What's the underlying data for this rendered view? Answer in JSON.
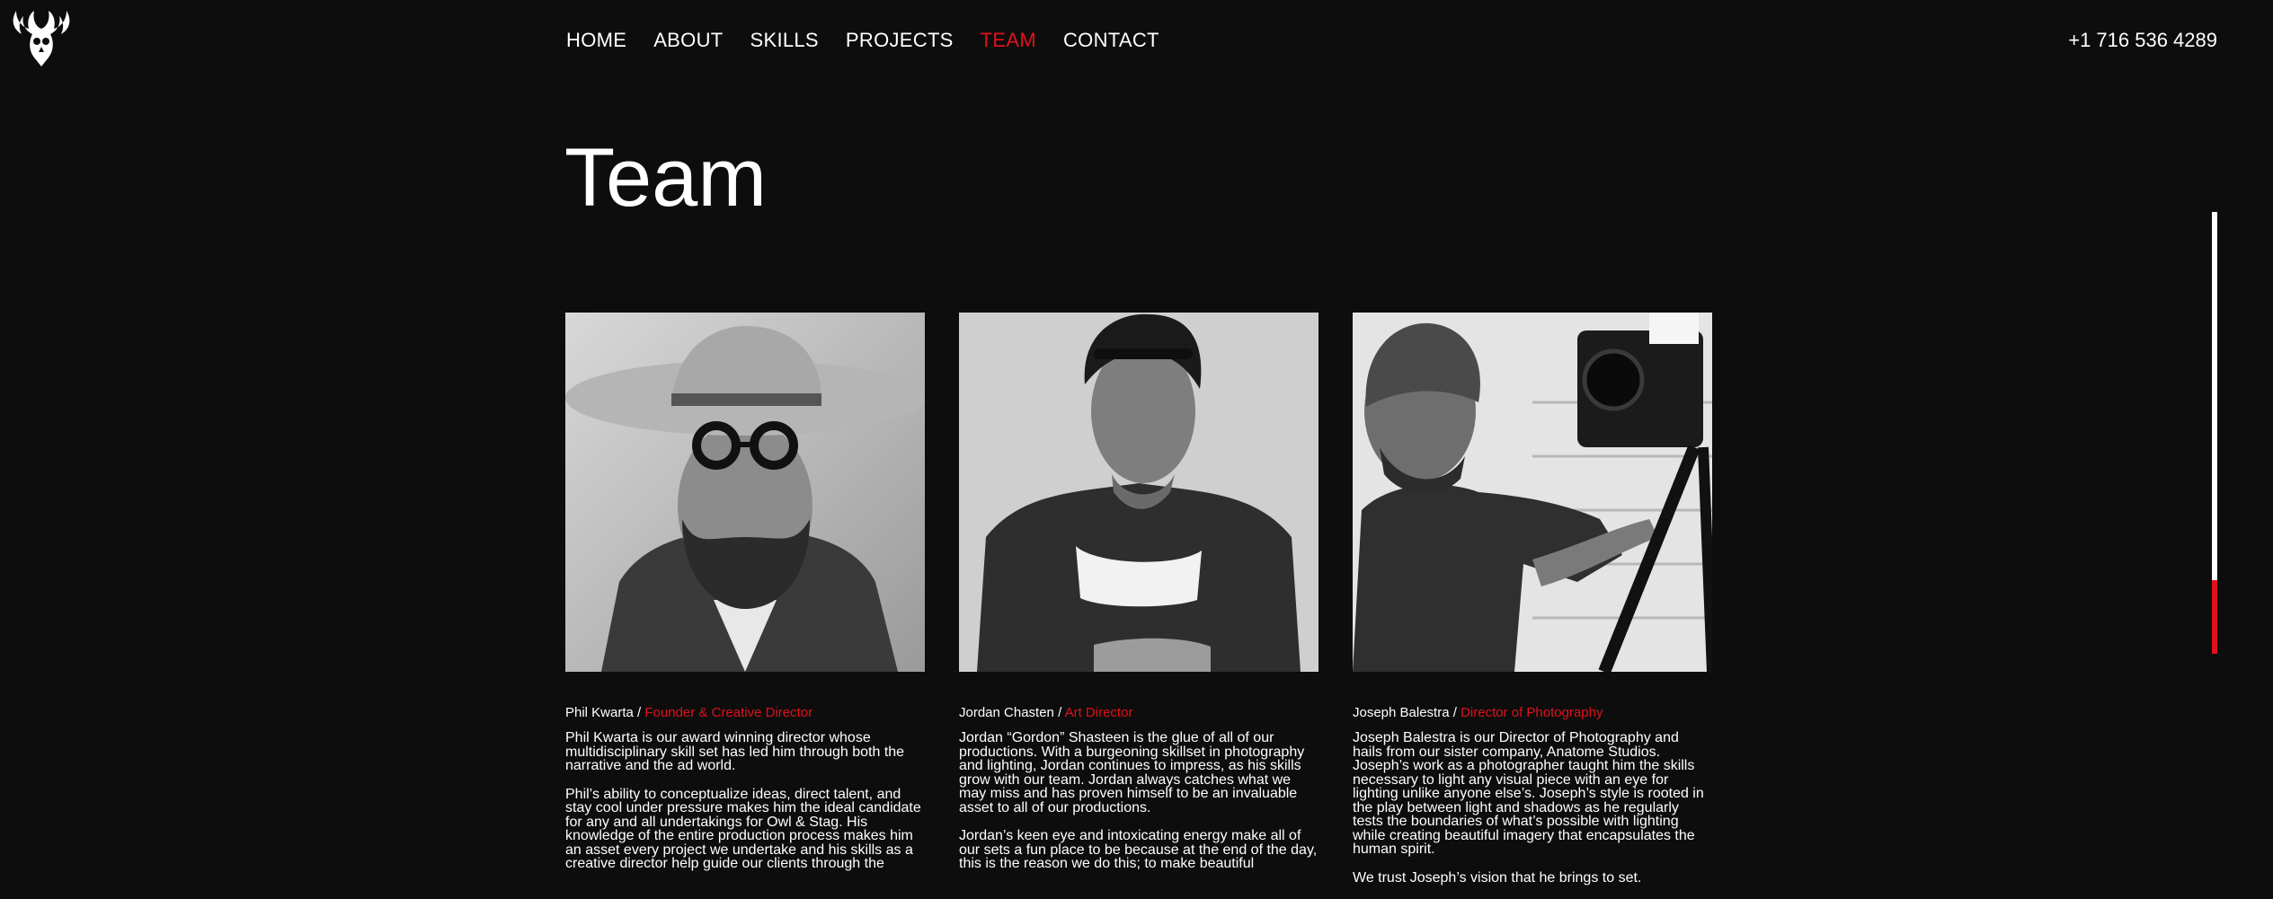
{
  "nav": {
    "items": [
      {
        "label": "HOME"
      },
      {
        "label": "ABOUT"
      },
      {
        "label": "SKILLS"
      },
      {
        "label": "PROJECTS"
      },
      {
        "label": "TEAM",
        "active": true
      },
      {
        "label": "CONTACT"
      }
    ],
    "phone": "+1 716 536 4289"
  },
  "page": {
    "title": "Team"
  },
  "colors": {
    "background": "#0d0d0d",
    "accent": "#e0111b",
    "text": "#ffffff"
  },
  "team": [
    {
      "name": "Phil Kwarta /",
      "role": "Founder & Creative Director",
      "bio": [
        "Phil Kwarta is our award winning director whose multidisciplinary skill set has led him through both the narrative and the ad world.",
        "Phil’s ability to conceptualize ideas, direct talent, and stay cool under pressure makes him the ideal candidate for any and all undertakings for Owl & Stag. His knowledge of the entire production process makes him an asset every project we undertake and his skills as a creative director help guide our clients through the"
      ]
    },
    {
      "name": "Jordan Chasten /",
      "role": "Art Director",
      "bio": [
        "Jordan “Gordon” Shasteen is the glue of all of our productions. With a burgeoning skillset in photography and lighting, Jordan continues to impress, as his skills grow with our team. Jordan always catches what we may miss and has proven himself to be an invaluable asset to all of our productions.",
        "Jordan’s keen eye and intoxicating energy make all of our sets a fun place to be because at the end of the day, this is the reason we do this; to make beautiful"
      ]
    },
    {
      "name": "Joseph Balestra /",
      "role": "Director of Photography",
      "bio": [
        "Joseph Balestra is our Director of Photography and hails from our sister company, Anatome Studios. Joseph’s work as a photographer taught him the skills necessary to light any visual piece with an eye for lighting unlike anyone else’s. Joseph’s style is rooted in the play between light and shadows as he regularly tests the boundaries of what’s possible with lighting while creating beautiful imagery that encapsulates the human spirit.",
        "We trust Joseph’s vision that he brings to set."
      ]
    }
  ]
}
